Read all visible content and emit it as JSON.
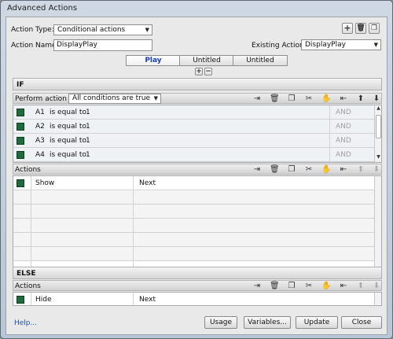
{
  "window": {
    "title": "Advanced Actions"
  },
  "top": {
    "action_type_label": "Action Type:",
    "action_type_value": "Conditional actions",
    "action_name_label": "Action Name:",
    "action_name_value": "DisplayPlay",
    "existing_actions_label": "Existing Actions:",
    "existing_actions_value": "DisplayPlay",
    "icons": [
      "add-icon",
      "delete-icon",
      "duplicate-icon"
    ]
  },
  "tabs": [
    {
      "label": "Play",
      "active": true
    },
    {
      "label": "Untitled",
      "active": false
    },
    {
      "label": "Untitled",
      "active": false
    }
  ],
  "tab_controls": {
    "add": "+",
    "remove": "−"
  },
  "if_section": {
    "title": "IF",
    "perform_label": "Perform action if:",
    "perform_value": "All conditions are true",
    "conditions": [
      {
        "var": "A1",
        "op": "is equal to",
        "value": "1",
        "logic": "AND"
      },
      {
        "var": "A2",
        "op": "is equal to",
        "value": "1",
        "logic": "AND"
      },
      {
        "var": "A3",
        "op": "is equal to",
        "value": "1",
        "logic": "AND"
      },
      {
        "var": "A4",
        "op": "is equal to",
        "value": "1",
        "logic": "AND"
      }
    ]
  },
  "actions_section": {
    "title": "Actions",
    "rows": [
      {
        "action": "Show",
        "target": "Next"
      }
    ]
  },
  "else_section": {
    "title": "ELSE",
    "actions_title": "Actions",
    "rows": [
      {
        "action": "Hide",
        "target": "Next"
      }
    ]
  },
  "toolbar_icons": [
    "insert-icon",
    "delete-icon",
    "copy-icon",
    "cut-icon",
    "paste-icon",
    "insert-after-icon",
    "move-up-icon",
    "move-down-icon"
  ],
  "footer": {
    "help": "Help...",
    "usage": "Usage",
    "variables": "Variables...",
    "update": "Update",
    "close": "Close"
  }
}
